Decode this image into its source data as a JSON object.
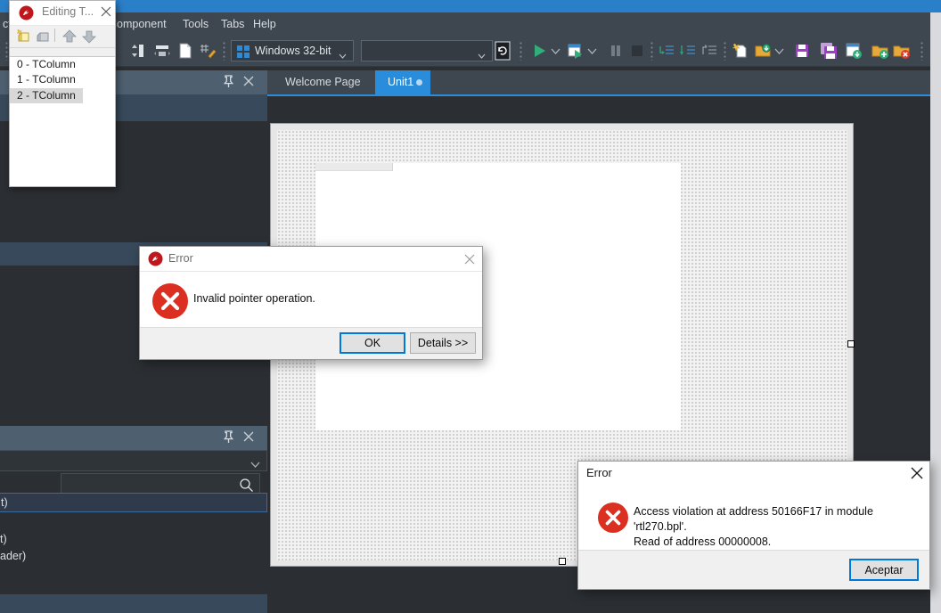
{
  "app": {
    "menus": [
      "ct",
      "Component",
      "Tools",
      "Tabs",
      "Help"
    ],
    "platform_combo": {
      "value": "Windows 32-bit",
      "icon": "windows-logo-icon"
    },
    "config_combo": {
      "value": "",
      "placeholder": ""
    },
    "toolbar_icons": [
      "align-to-grid-icon",
      "align-palette-icon",
      "new-file-icon",
      "form-grid-icon",
      "run-icon",
      "run-dropdown-icon",
      "run-without-debug-icon",
      "run-options-dropdown-icon",
      "pause-icon",
      "stop-icon",
      "step-over-icon",
      "trace-into-icon",
      "run-to-cursor-icon",
      "new-item-icon",
      "open-project-icon",
      "open-dropdown-icon",
      "save-icon",
      "save-all-icon",
      "save-project-as-icon",
      "add-to-project-icon",
      "remove-from-project-icon",
      "refresh-device-icon"
    ]
  },
  "tabs": {
    "items": [
      {
        "label": "Welcome Page",
        "active": false,
        "modified": false
      },
      {
        "label": "Unit1",
        "active": true,
        "modified": true
      }
    ]
  },
  "panels": {
    "structure": {
      "pin_icon": "pin-icon",
      "close_icon": "close-icon"
    },
    "object_inspector": {
      "pin_icon": "pin-icon",
      "close_icon": "close-icon",
      "component_combo_value": "",
      "search_value": "",
      "search_icon": "search-icon",
      "rows": [
        {
          "text": "t)",
          "selected": true
        },
        {
          "text": "",
          "selected": false
        },
        {
          "text": "t)",
          "selected": false
        },
        {
          "text": "ader)",
          "selected": false
        }
      ]
    }
  },
  "collection_editor": {
    "title": "Editing T...",
    "app_icon": "delphi-icon",
    "close_icon": "close-icon",
    "toolbar": [
      {
        "name": "add-item-icon",
        "label": "Add New"
      },
      {
        "name": "delete-item-icon",
        "label": "Delete"
      },
      {
        "name": "move-up-icon",
        "label": "Move Up"
      },
      {
        "name": "move-down-icon",
        "label": "Move Down"
      }
    ],
    "items": [
      {
        "label": "0 - TColumn",
        "selected": false
      },
      {
        "label": "1 - TColumn",
        "selected": false
      },
      {
        "label": "2 - TColumn",
        "selected": true
      }
    ]
  },
  "dialog_invalid_pointer": {
    "title": "Error",
    "app_icon": "delphi-icon",
    "close_icon": "close-icon",
    "error_icon": "error-x-icon",
    "message": "Invalid pointer operation.",
    "buttons": [
      {
        "label": "OK",
        "focused": true
      },
      {
        "label": "Details >>",
        "focused": false
      }
    ]
  },
  "dialog_access_violation": {
    "title": "Error",
    "close_icon": "close-icon",
    "error_icon": "error-x-icon",
    "message": "Access violation at address 50166F17 in module 'rtl270.bpl'.\nRead of address 00000008.",
    "buttons": [
      {
        "label": "Aceptar",
        "focused": true
      }
    ]
  },
  "colors": {
    "accent_blue": "#2a8ddb",
    "title_blue": "#2a7fc9",
    "toolbar_bg": "#3e4750",
    "panel_bg": "#2b2f33",
    "dock_header": "#4e5f70",
    "error_red": "#da2f21",
    "focus_blue": "#0078d7"
  }
}
